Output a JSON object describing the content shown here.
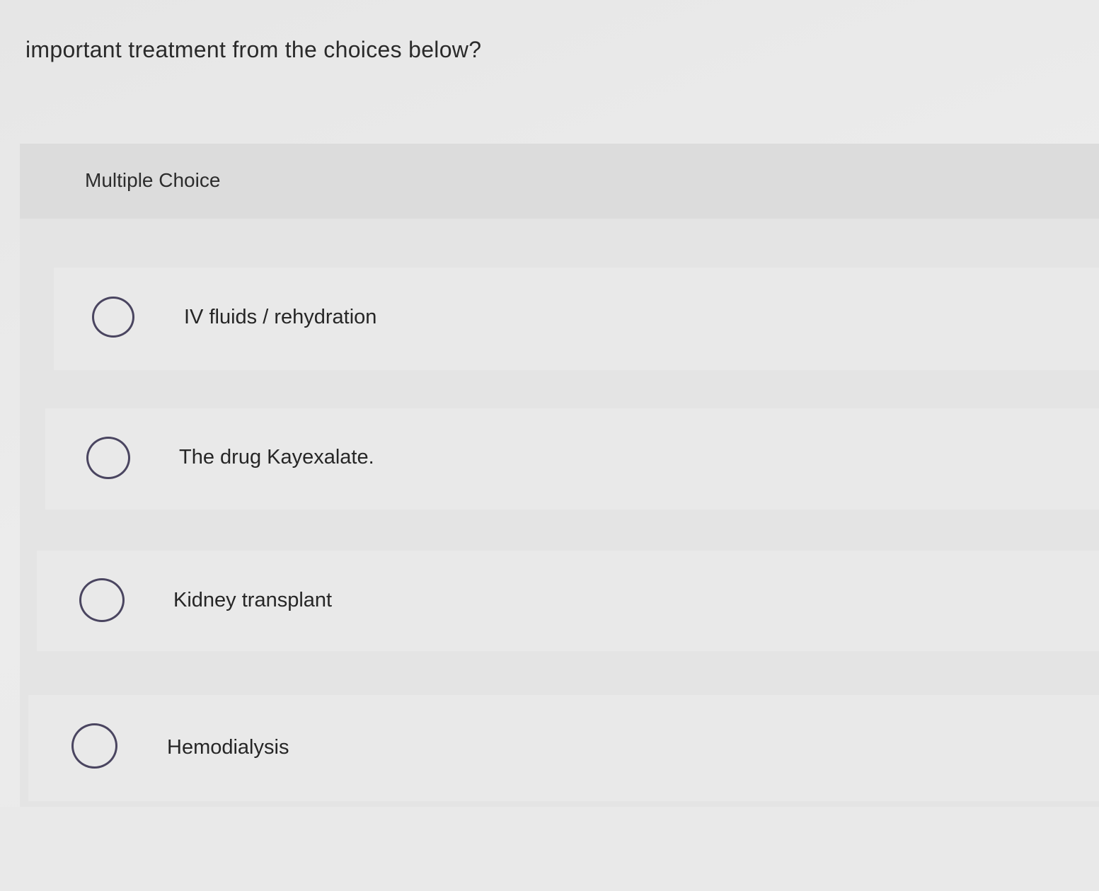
{
  "question": {
    "text": "important treatment from the choices below?"
  },
  "multiple_choice": {
    "header_label": "Multiple Choice",
    "options": [
      {
        "label": "IV fluids / rehydration",
        "selected": false
      },
      {
        "label": "The drug Kayexalate.",
        "selected": false
      },
      {
        "label": "Kidney transplant",
        "selected": false
      },
      {
        "label": "Hemodialysis",
        "selected": false
      }
    ]
  },
  "colors": {
    "radio_border": "#4a4560",
    "panel_header": "#dcdcdc",
    "option_background": "#e9e9e9"
  }
}
